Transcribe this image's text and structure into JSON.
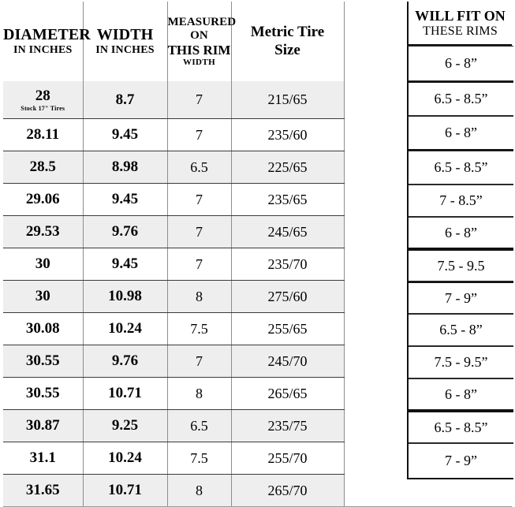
{
  "table": {
    "headers": [
      {
        "line1": "DIAMETER",
        "line2": "IN INCHES"
      },
      {
        "line1": "WIDTH",
        "line2": "IN INCHES"
      },
      {
        "line1": "MEASURED ON",
        "line2": "THIS RIM",
        "line3": "WIDTH"
      },
      {
        "line1": "Metric Tire",
        "line2": "Size"
      },
      {
        "line1": "WILL FIT ON",
        "line2": "THESE RIMS"
      }
    ],
    "rows": [
      {
        "diameter": "28",
        "note": "Stock 17\" Tires",
        "width": "8.7",
        "rim": "7",
        "metric": "215/65",
        "fits": "6 - 8”"
      },
      {
        "diameter": "28.11",
        "note": "",
        "width": "9.45",
        "rim": "7",
        "metric": "235/60",
        "fits": "6.5 - 8.5”"
      },
      {
        "diameter": "28.5",
        "note": "",
        "width": "8.98",
        "rim": "6.5",
        "metric": "225/65",
        "fits": "6 - 8”"
      },
      {
        "diameter": "29.06",
        "note": "",
        "width": "9.45",
        "rim": "7",
        "metric": "235/65",
        "fits": "6.5 - 8.5”"
      },
      {
        "diameter": "29.53",
        "note": "",
        "width": "9.76",
        "rim": "7",
        "metric": "245/65",
        "fits": "7 - 8.5”"
      },
      {
        "diameter": "30",
        "note": "",
        "width": "9.45",
        "rim": "7",
        "metric": "235/70",
        "fits": "6 - 8”"
      },
      {
        "diameter": "30",
        "note": "",
        "width": "10.98",
        "rim": "8",
        "metric": "275/60",
        "fits": "7.5 - 9.5"
      },
      {
        "diameter": "30.08",
        "note": "",
        "width": "10.24",
        "rim": "7.5",
        "metric": "255/65",
        "fits": "7 - 9”"
      },
      {
        "diameter": "30.55",
        "note": "",
        "width": "9.76",
        "rim": "7",
        "metric": "245/70",
        "fits": "6.5 - 8”"
      },
      {
        "diameter": "30.55",
        "note": "",
        "width": "10.71",
        "rim": "8",
        "metric": "265/65",
        "fits": "7.5 - 9.5”"
      },
      {
        "diameter": "30.87",
        "note": "",
        "width": "9.25",
        "rim": "6.5",
        "metric": "235/75",
        "fits": "6 - 8”"
      },
      {
        "diameter": "31.1",
        "note": "",
        "width": "10.24",
        "rim": "7.5",
        "metric": "255/70",
        "fits": "6.5 - 8.5”"
      },
      {
        "diameter": "31.65",
        "note": "",
        "width": "10.71",
        "rim": "8",
        "metric": "265/70",
        "fits": "7 - 9”"
      }
    ],
    "colors": {
      "shade_row": "#eeeeee",
      "plain_row": "#ffffff",
      "text": "#000000",
      "grid_line": "#8e8e8e",
      "heavy_line": "#111111"
    }
  }
}
